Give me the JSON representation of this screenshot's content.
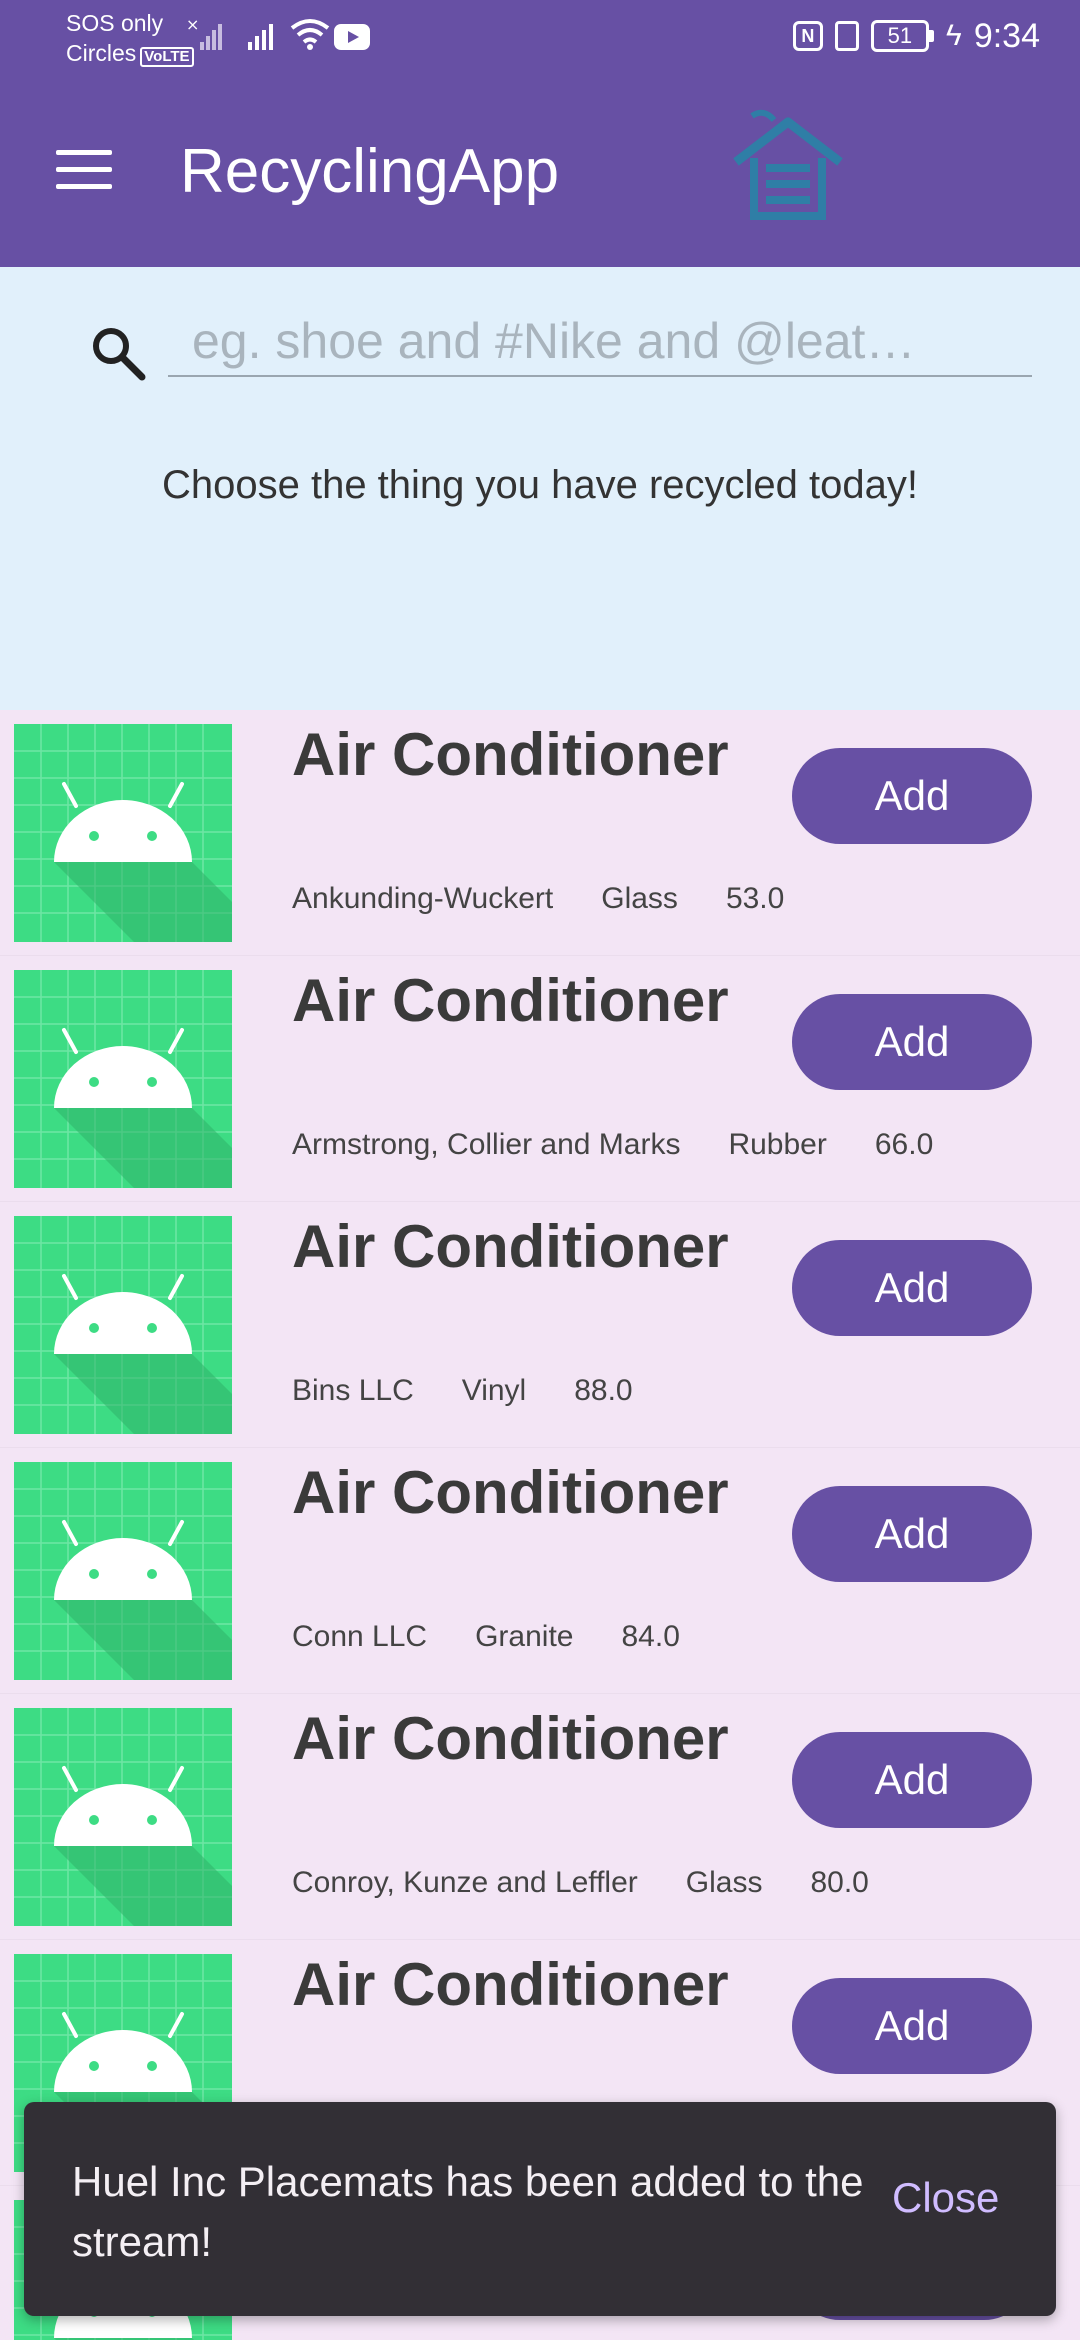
{
  "status_bar": {
    "carrier_line1": "SOS only",
    "carrier_line2": "Circles",
    "volte": "VoLTE",
    "battery": "51",
    "time": "9:34",
    "icons": [
      "signal-x-icon",
      "signal-icon",
      "wifi-icon",
      "youtube-icon",
      "nfc-icon",
      "vibrate-icon",
      "battery-icon",
      "charging-icon"
    ]
  },
  "app_bar": {
    "title": "RecyclingApp",
    "menu_icon": "hamburger-menu-icon",
    "logo_icon": "recycling-house-icon",
    "background": "#6750a4",
    "logo_color": "#2f7ea6"
  },
  "search": {
    "placeholder": "eg. shoe and #Nike and @leat…",
    "value": "",
    "icon": "search-icon",
    "prompt": "Choose the thing you have recycled today!"
  },
  "items": [
    {
      "title": "Air Conditioner",
      "brand": "Ankunding-Wuckert",
      "material": "Glass",
      "value": "53.0",
      "button": "Add"
    },
    {
      "title": "Air Conditioner",
      "brand": "Armstrong, Collier and Marks",
      "material": "Rubber",
      "value": "66.0",
      "button": "Add"
    },
    {
      "title": "Air Conditioner",
      "brand": "Bins LLC",
      "material": "Vinyl",
      "value": "88.0",
      "button": "Add"
    },
    {
      "title": "Air Conditioner",
      "brand": "Conn LLC",
      "material": "Granite",
      "value": "84.0",
      "button": "Add"
    },
    {
      "title": "Air Conditioner",
      "brand": "Conroy, Kunze and Leffler",
      "material": "Glass",
      "value": "80.0",
      "button": "Add"
    },
    {
      "title": "Air Conditioner",
      "brand": "",
      "material": "",
      "value": "",
      "button": "Add"
    },
    {
      "title": "",
      "brand": "",
      "material": "",
      "value": "",
      "button": ""
    }
  ],
  "snackbar": {
    "message": "Huel Inc Placemats has been added to the stream!",
    "action": "Close"
  },
  "colors": {
    "primary": "#6750a4",
    "search_bg": "#e1f0fb",
    "list_bg": "#f3e5f5",
    "thumb_green": "#3ddc84",
    "snackbar_bg": "#322f35",
    "snackbar_action": "#d0bcff"
  }
}
